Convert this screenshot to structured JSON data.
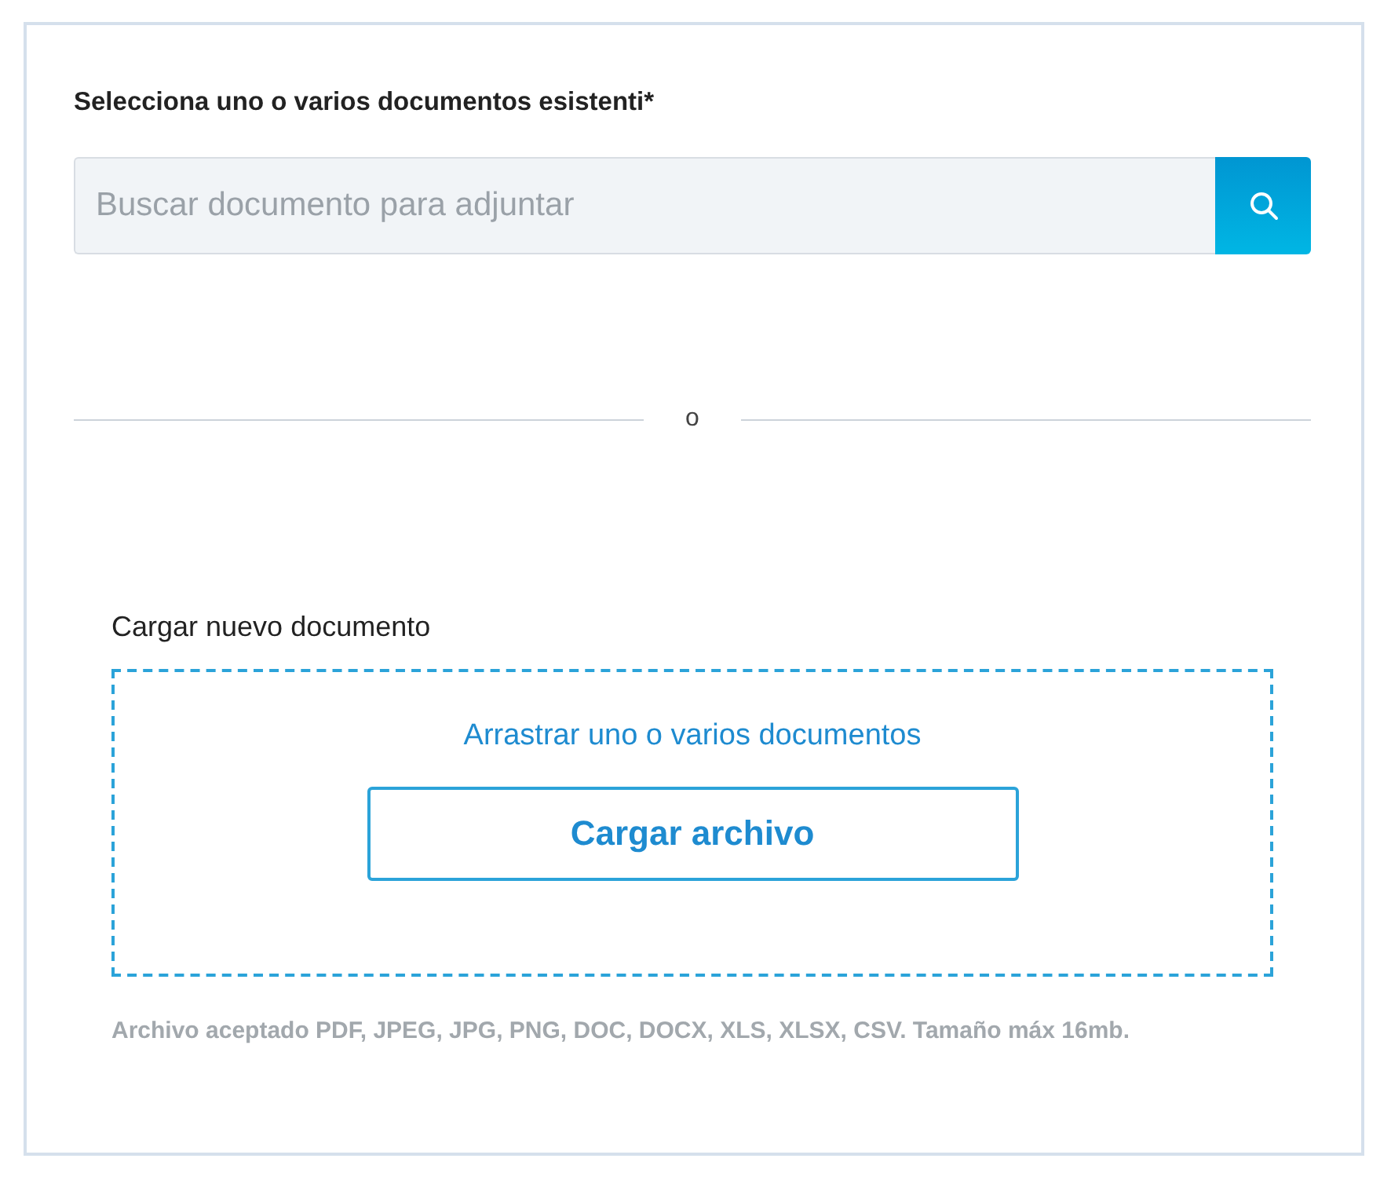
{
  "search_section": {
    "label": "Selecciona uno o varios documentos esistenti*",
    "search": {
      "placeholder": "Buscar documento para adjuntar"
    }
  },
  "separator": {
    "text": "o"
  },
  "upload_section": {
    "title": "Cargar nuevo documento",
    "dropzone_text": "Arrastrar uno o varios documentos",
    "button": "Cargar archivo",
    "note": "Archivo aceptado PDF, JPEG, JPG, PNG, DOC, DOCX, XLS, XLSX, CSV. Tamaño máx 16mb."
  }
}
